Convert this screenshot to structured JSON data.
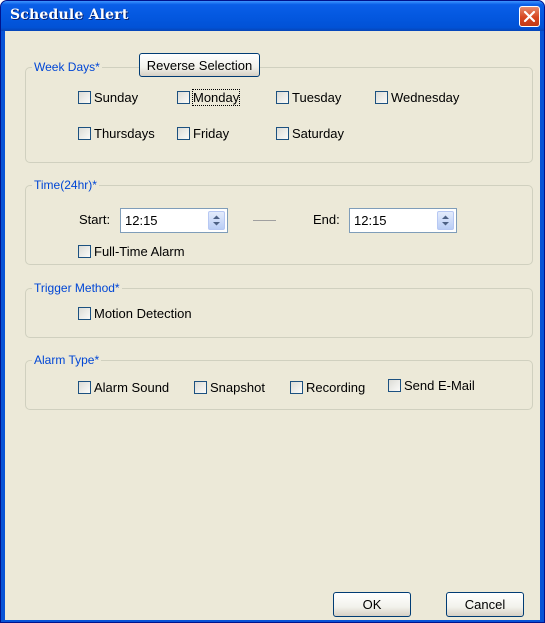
{
  "window": {
    "title": "Schedule Alert"
  },
  "weekdays": {
    "legend": "Week Days*",
    "reverse_label": "Reverse Selection",
    "days": [
      "Sunday",
      "Monday",
      "Tuesday",
      "Wednesday",
      "Thursdays",
      "Friday",
      "Saturday"
    ]
  },
  "time": {
    "legend": "Time(24hr)*",
    "start_label": "Start:",
    "start_value": "12:15",
    "end_label": "End:",
    "end_value": "12:15",
    "fulltime_label": "Full-Time Alarm"
  },
  "trigger": {
    "legend": "Trigger Method*",
    "motion_label": "Motion Detection"
  },
  "alarm": {
    "legend": "Alarm Type*",
    "types": [
      "Alarm Sound",
      "Snapshot",
      "Recording",
      "Send E-Mail"
    ]
  },
  "footer": {
    "ok_label": "OK",
    "cancel_label": "Cancel"
  },
  "colors": {
    "titlebar": "#0458e0",
    "legend": "#0046d5",
    "client": "#ece9d8",
    "close": "#d7461f"
  },
  "icons": [
    "close-icon",
    "spin-up-icon",
    "spin-down-icon"
  ]
}
